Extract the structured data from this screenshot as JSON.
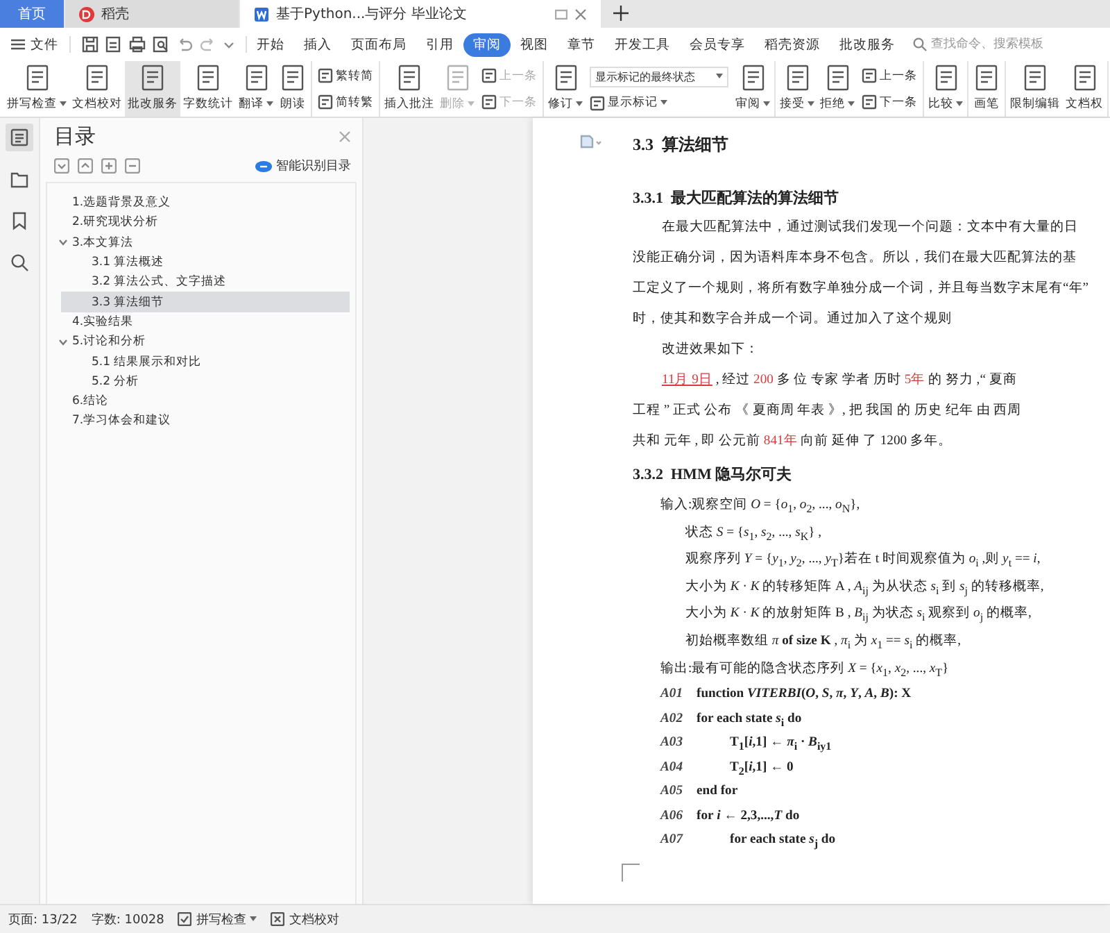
{
  "tabs": [
    {
      "label": "首页",
      "kind": "home",
      "selected": false
    },
    {
      "label": "稻壳",
      "kind": "app",
      "selected": false
    },
    {
      "label": "基于Python...与评分 毕业论文",
      "kind": "doc",
      "selected": true
    }
  ],
  "menu": {
    "file": "文件",
    "tabs": [
      {
        "label": "开始",
        "selected": false
      },
      {
        "label": "插入",
        "selected": false
      },
      {
        "label": "页面布局",
        "selected": false
      },
      {
        "label": "引用",
        "selected": false
      },
      {
        "label": "审阅",
        "selected": true
      },
      {
        "label": "视图",
        "selected": false
      },
      {
        "label": "章节",
        "selected": false
      },
      {
        "label": "开发工具",
        "selected": false
      },
      {
        "label": "会员专享",
        "selected": false
      },
      {
        "label": "稻壳资源",
        "selected": false
      },
      {
        "label": "批改服务",
        "selected": false
      }
    ],
    "search": {
      "placeholder": "查找命令、搜索模板"
    }
  },
  "ribbon": [
    [
      {
        "kind": "large",
        "label": "拼写检查",
        "menu": true,
        "disabled": false,
        "highlighted": false
      },
      {
        "kind": "large",
        "label": "文档校对",
        "menu": false,
        "disabled": false,
        "highlighted": false
      },
      {
        "kind": "large",
        "label": "批改服务",
        "menu": false,
        "disabled": false,
        "highlighted": true
      },
      {
        "kind": "large",
        "label": "字数统计",
        "menu": false,
        "disabled": false,
        "highlighted": false
      },
      {
        "kind": "large",
        "label": "翻译",
        "menu": true,
        "disabled": false,
        "highlighted": false
      },
      {
        "kind": "large",
        "label": "朗读",
        "menu": false,
        "disabled": false,
        "highlighted": false
      }
    ],
    [
      {
        "kind": "stack",
        "highlighted": false,
        "items": [
          {
            "kind": "button",
            "label": "繁转简",
            "menu": false,
            "disabled": false
          },
          {
            "kind": "button",
            "label": "简转繁",
            "menu": false,
            "disabled": false
          }
        ]
      }
    ],
    [
      {
        "kind": "large",
        "label": "插入批注",
        "menu": false,
        "disabled": false,
        "highlighted": false
      },
      {
        "kind": "large",
        "label": "删除",
        "menu": true,
        "disabled": true,
        "highlighted": false
      },
      {
        "kind": "stack",
        "highlighted": false,
        "items": [
          {
            "kind": "button",
            "label": "上一条",
            "menu": false,
            "disabled": true
          },
          {
            "kind": "button",
            "label": "下一条",
            "menu": false,
            "disabled": true
          }
        ]
      }
    ],
    [
      {
        "kind": "large",
        "label": "修订",
        "menu": true,
        "disabled": false,
        "highlighted": false
      },
      {
        "kind": "stack",
        "highlighted": false,
        "items": [
          {
            "kind": "select",
            "label": "显示标记的最终状态",
            "menu": true,
            "disabled": false
          },
          {
            "kind": "button",
            "label": "显示标记",
            "menu": true,
            "disabled": false
          }
        ]
      },
      {
        "kind": "large",
        "label": "审阅",
        "menu": true,
        "disabled": false,
        "highlighted": false
      }
    ],
    [
      {
        "kind": "large",
        "label": "接受",
        "menu": true,
        "disabled": false,
        "highlighted": false
      },
      {
        "kind": "large",
        "label": "拒绝",
        "menu": true,
        "disabled": false,
        "highlighted": false
      },
      {
        "kind": "stack",
        "highlighted": false,
        "items": [
          {
            "kind": "button",
            "label": "上一条",
            "menu": false,
            "disabled": false
          },
          {
            "kind": "button",
            "label": "下一条",
            "menu": false,
            "disabled": false
          }
        ]
      }
    ],
    [
      {
        "kind": "large",
        "label": "比较",
        "menu": true,
        "disabled": false,
        "highlighted": false
      }
    ],
    [
      {
        "kind": "large",
        "label": "画笔",
        "menu": false,
        "disabled": false,
        "highlighted": false
      }
    ],
    [
      {
        "kind": "large",
        "label": "限制编辑",
        "menu": false,
        "disabled": false,
        "highlighted": false
      },
      {
        "kind": "large",
        "label": "文档权",
        "menu": false,
        "disabled": false,
        "highlighted": false
      }
    ]
  ],
  "nav_rail": [
    {
      "selected": true
    },
    {
      "selected": false
    },
    {
      "selected": false
    },
    {
      "selected": false
    }
  ],
  "toc": {
    "title": "目录",
    "smart": "智能识别目录",
    "items": [
      {
        "label": "1.选题背景及意义",
        "selected": false
      },
      {
        "label": "2.研究现状分析",
        "selected": false
      },
      {
        "label": "3.本文算法",
        "selected": false,
        "expanded": true,
        "children": [
          {
            "label": "3.1  算法概述",
            "selected": false
          },
          {
            "label": "3.2  算法公式、文字描述",
            "selected": false
          },
          {
            "label": "3.3  算法细节",
            "selected": true
          }
        ]
      },
      {
        "label": "4.实验结果",
        "selected": false
      },
      {
        "label": "5.讨论和分析",
        "selected": false,
        "expanded": true,
        "children": [
          {
            "label": "5.1 结果展示和对比",
            "selected": false
          },
          {
            "label": "5.2 分析",
            "selected": false
          }
        ]
      },
      {
        "label": "6.结论",
        "selected": false
      },
      {
        "label": "7.学习体会和建议",
        "selected": false
      }
    ]
  },
  "document": {
    "blocks": [
      {
        "kind": "h2",
        "text": "3.3  算法细节"
      },
      {
        "kind": "h3",
        "text": "3.3.1  最大匹配算法的算法细节"
      },
      {
        "kind": "para",
        "lines": [
          "在最大匹配算法中，通过测试我们发现一个问题：文本中有大量的日",
          "没能正确分词，因为语料库本身不包含。所以，我们在最大匹配算法的基",
          "工定义了一个规则，将所有数字单独分成一个词，并且每当数字末尾有“年”",
          "时，使其和数字合并成一个词。通过加入了这个规则"
        ]
      },
      {
        "kind": "para",
        "lines": [
          "改进效果如下："
        ]
      },
      {
        "kind": "example",
        "lines": [
          [
            {
              "kind": "date",
              "text": "11月 9日"
            },
            {
              "kind": "text",
              "text": " , 经过 "
            },
            {
              "kind": "number",
              "text": "200"
            },
            {
              "kind": "text",
              "text": " 多 位 专家 学者 历时 "
            },
            {
              "kind": "number",
              "text": "5年"
            },
            {
              "kind": "text",
              "text": " 的 努力 ,“ 夏商"
            }
          ],
          [
            {
              "kind": "text",
              "text": "工程 ” 正式 公布 《 夏商周 年表 》, 把 我国 的 历史 纪年 由 西周"
            }
          ],
          [
            {
              "kind": "text",
              "text": "共和 元年 , 即 公元前 "
            },
            {
              "kind": "number",
              "text": "841年"
            },
            {
              "kind": "text",
              "text": " 向前 延伸 了 1200 多年。"
            }
          ]
        ]
      },
      {
        "kind": "h3",
        "text": "3.3.2  HMM 隐马尔可夫"
      },
      {
        "kind": "math",
        "lines": [
          {
            "text": "输入:观察空间  *O* = {*o*$_{1}$, *o*$_{2}$, ..., *o*$_{N}$},",
            "children": [
              {
                "text": "状态  *S* = {*s*$_{1}$, *s*$_{2}$, ..., *s*$_{K}$} ,"
              },
              {
                "text": "观察序列 *Y* = {*y*$_{1}$, *y*$_{2}$, ..., *y*$_{T}$}若在 t 时间观察值为 *o*$_{i}$ ,则 *y*$_{t}$ == *i*,"
              },
              {
                "text": "大小为 *K* · *K* 的转移矩阵 A , *A*$_{ij}$ 为从状态 *s*$_{i}$ 到 *s*$_{j}$ 的转移概率,"
              },
              {
                "text": "大小为 *K* · *K* 的放射矩阵 B , *B*$_{ij}$ 为状态 *s*$_{i}$ 观察到 *o*$_{j}$ 的概率,"
              },
              {
                "text": "初始概率数组 *π* **of size K** , *π*$_{i}$ 为 *x*$_{1}$ == *s*$_{i}$ 的概率,"
              }
            ]
          },
          {
            "text": "输出:最有可能的隐含状态序列 *X* = {*x*$_{1}$, *x*$_{2}$, ..., *x*$_{T}$}"
          }
        ]
      },
      {
        "kind": "algorithm",
        "lines": [
          {
            "label": "A01",
            "code": "**function**  *VITERBI*(*O*, *S*, *π*, *Y*, *A*, *B*): X"
          },
          {
            "label": "A02",
            "code": "**for each state**  *s*$_{i}$  **do**",
            "children": [
              {
                "label": "A03",
                "code": "**T**$_{1}$[*i*,1] ← *π*$_{i}$ · *B*$_{iy1}$"
              },
              {
                "label": "A04",
                "code": "**T**$_{2}$[*i*,1] ← 0"
              }
            ]
          },
          {
            "label": "A05",
            "code": "**end for**"
          },
          {
            "label": "A06",
            "code": "**for**  *i* ← 2,3,...,*T*  **do**",
            "children": [
              {
                "label": "A07",
                "code": "**for each state**  *s*$_{j}$  **do**"
              }
            ]
          }
        ]
      }
    ]
  },
  "status_bar": {
    "page": "页面: 13/22",
    "words": "字数: 10028",
    "spell": "拼写检查",
    "proof": "文档校对"
  }
}
